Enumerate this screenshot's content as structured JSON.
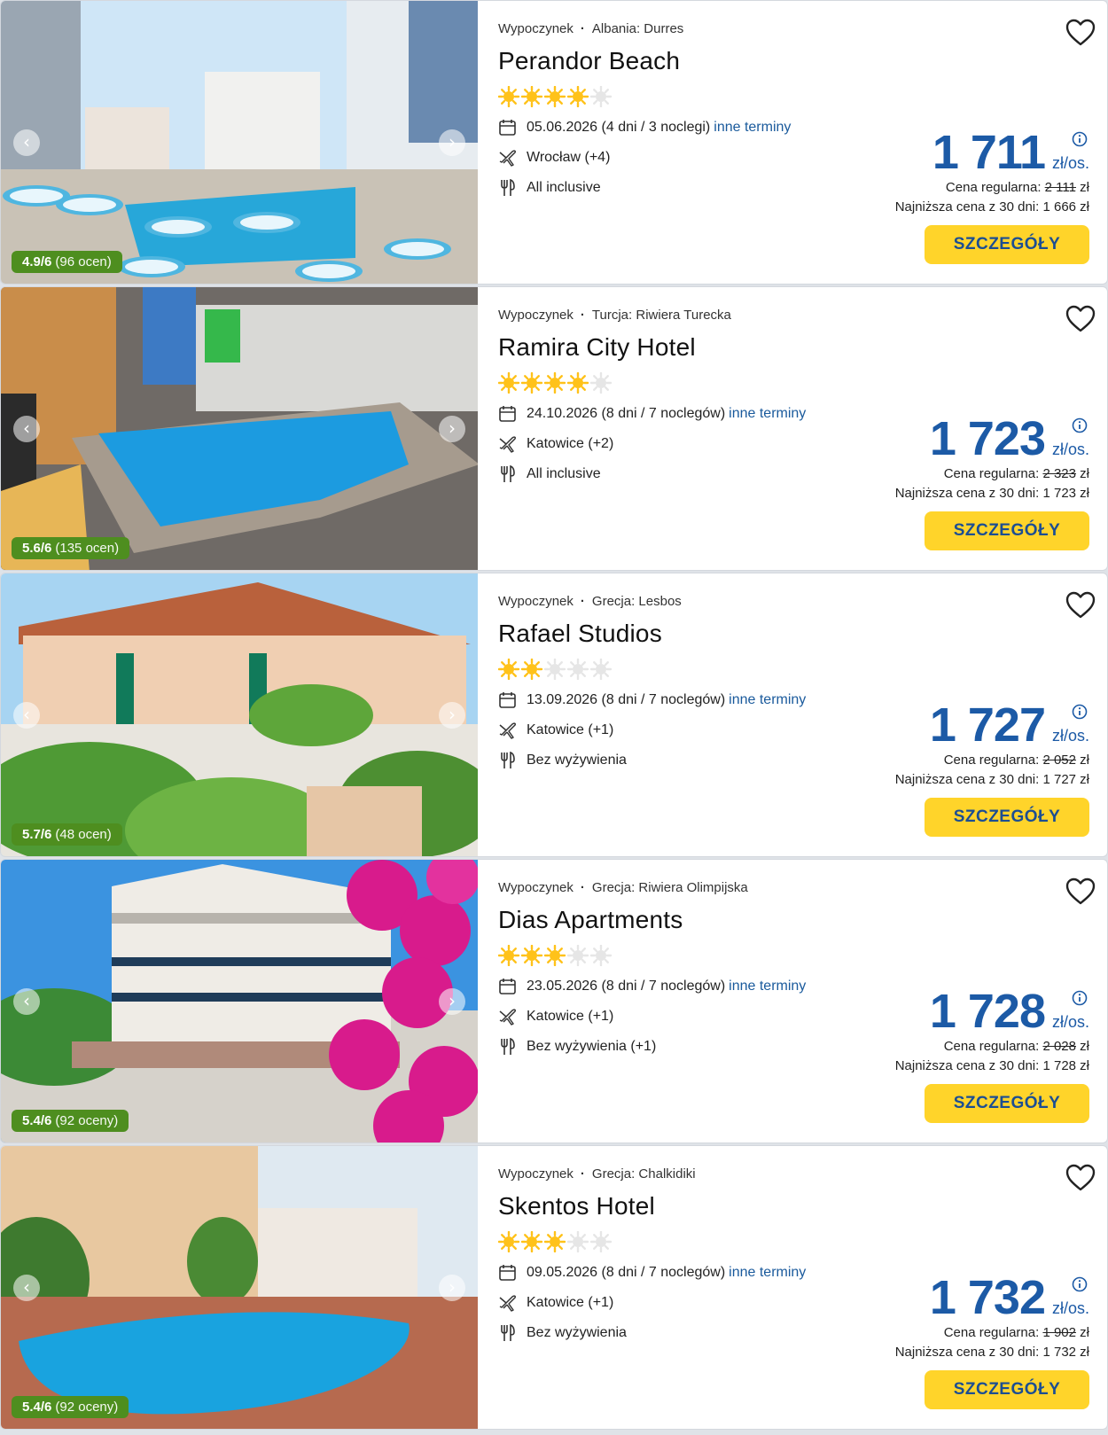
{
  "offers": [
    {
      "category": "Wypoczynek",
      "location": "Albania: Durres",
      "name": "Perandor Beach",
      "stars": 4,
      "date": "05.06.2026 (4 dni / 3 noclegi)",
      "more_dates": "inne terminy",
      "departure": "Wrocław (+4)",
      "board": "All inclusive",
      "price": "1 711",
      "price_unit": "zł/os.",
      "regular_label": "Cena regularna:",
      "regular_price": "2 111",
      "regular_currency": "zł",
      "lowest": "Najniższa cena z 30 dni: 1 666 zł",
      "button": "SZCZEGÓŁY",
      "rating_score": "4.9/6",
      "rating_count": "(96 ocen)"
    },
    {
      "category": "Wypoczynek",
      "location": "Turcja: Riwiera Turecka",
      "name": "Ramira City Hotel",
      "stars": 4,
      "date": "24.10.2026 (8 dni / 7 noclegów)",
      "more_dates": "inne terminy",
      "departure": "Katowice (+2)",
      "board": "All inclusive",
      "price": "1 723",
      "price_unit": "zł/os.",
      "regular_label": "Cena regularna:",
      "regular_price": "2 323",
      "regular_currency": "zł",
      "lowest": "Najniższa cena z 30 dni: 1 723 zł",
      "button": "SZCZEGÓŁY",
      "rating_score": "5.6/6",
      "rating_count": "(135 ocen)"
    },
    {
      "category": "Wypoczynek",
      "location": "Grecja: Lesbos",
      "name": "Rafael Studios",
      "stars": 2,
      "date": "13.09.2026 (8 dni / 7 noclegów)",
      "more_dates": "inne terminy",
      "departure": "Katowice (+1)",
      "board": "Bez wyżywienia",
      "price": "1 727",
      "price_unit": "zł/os.",
      "regular_label": "Cena regularna:",
      "regular_price": "2 052",
      "regular_currency": "zł",
      "lowest": "Najniższa cena z 30 dni: 1 727 zł",
      "button": "SZCZEGÓŁY",
      "rating_score": "5.7/6",
      "rating_count": "(48 ocen)"
    },
    {
      "category": "Wypoczynek",
      "location": "Grecja: Riwiera Olimpijska",
      "name": "Dias Apartments",
      "stars": 3,
      "date": "23.05.2026 (8 dni / 7 noclegów)",
      "more_dates": "inne terminy",
      "departure": "Katowice (+1)",
      "board": "Bez wyżywienia (+1)",
      "price": "1 728",
      "price_unit": "zł/os.",
      "regular_label": "Cena regularna:",
      "regular_price": "2 028",
      "regular_currency": "zł",
      "lowest": "Najniższa cena z 30 dni: 1 728 zł",
      "button": "SZCZEGÓŁY",
      "rating_score": "5.4/6",
      "rating_count": "(92 oceny)"
    },
    {
      "category": "Wypoczynek",
      "location": "Grecja: Chalkidiki",
      "name": "Skentos Hotel",
      "stars": 3,
      "date": "09.05.2026 (8 dni / 7 noclegów)",
      "more_dates": "inne terminy",
      "departure": "Katowice (+1)",
      "board": "Bez wyżywienia",
      "price": "1 732",
      "price_unit": "zł/os.",
      "regular_label": "Cena regularna:",
      "regular_price": "1 902",
      "regular_currency": "zł",
      "lowest": "Najniższa cena z 30 dni: 1 732 zł",
      "button": "SZCZEGÓŁY",
      "rating_score": "5.4/6",
      "rating_count": "(92 oceny)"
    }
  ],
  "colors": {
    "price": "#1c5aa6",
    "button_bg": "#ffd42a",
    "button_text": "#1c4e92",
    "rating_bg": "#4e8e1f",
    "star_on": "#ffc21a",
    "star_off": "#e6e6e6",
    "link": "#1a5a9c"
  },
  "icons": {
    "date": "calendar-icon",
    "departure": "plane-icon",
    "board": "cutlery-icon",
    "favourite": "heart-icon",
    "info": "info-icon",
    "prev": "chevron-left-icon",
    "next": "chevron-right-icon"
  }
}
